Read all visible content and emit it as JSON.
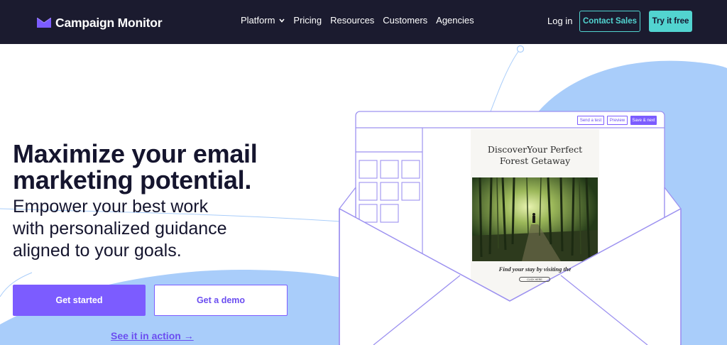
{
  "brand": {
    "name": "Campaign Monitor",
    "icon": "envelope-logo-icon",
    "color": "#7c5cff"
  },
  "nav": {
    "links": [
      {
        "label": "Platform",
        "has_dropdown": true
      },
      {
        "label": "Pricing"
      },
      {
        "label": "Resources"
      },
      {
        "label": "Customers"
      },
      {
        "label": "Agencies"
      }
    ],
    "login": "Log in",
    "contact_sales": "Contact Sales",
    "try_free": "Try it free"
  },
  "hero": {
    "headline_line1": "Maximize your email",
    "headline_line2": "marketing potential.",
    "subhead_line1": "Empower your best work",
    "subhead_line2": "with personalized guidance",
    "subhead_line3": "aligned to your goals.",
    "get_started": "Get started",
    "get_demo": "Get a demo",
    "see_in_action": "See it in action →"
  },
  "editor": {
    "send_test": "Send a test",
    "preview": "Preview",
    "save_next": "Save & next",
    "email_title_line1": "DiscoverYour Perfect",
    "email_title_line2": "Forest Getaway",
    "email_tagline": "Find your stay by visiting the",
    "email_cta": "CLICK HERE"
  },
  "colors": {
    "nav_bg": "#1b1b2f",
    "accent_purple": "#7c5cff",
    "accent_teal": "#52d4d0",
    "hero_blob": "#a9cdfa"
  }
}
